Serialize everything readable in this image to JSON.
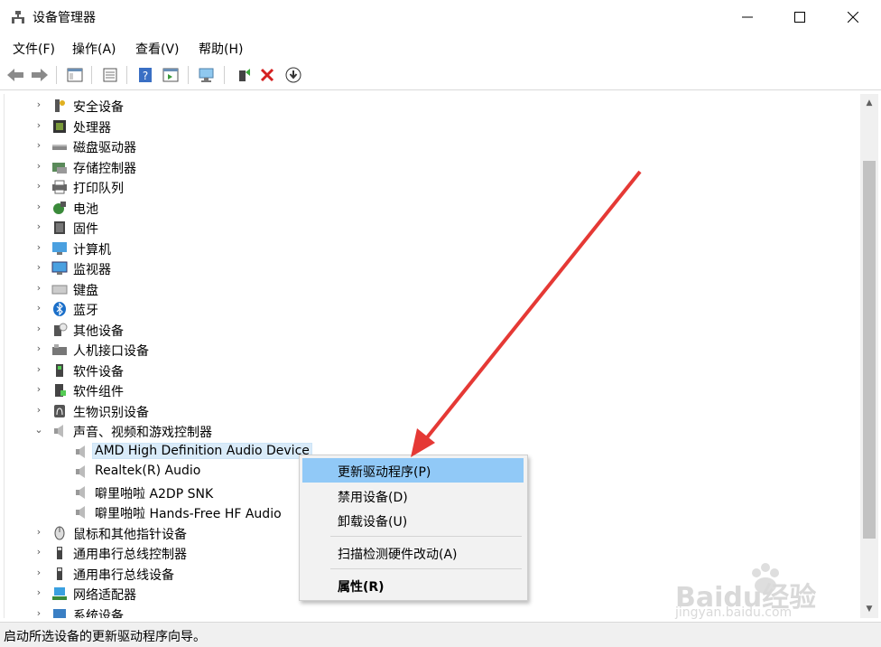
{
  "window": {
    "title": "设备管理器"
  },
  "menu": [
    "文件(F)",
    "操作(A)",
    "查看(V)",
    "帮助(H)"
  ],
  "tree": {
    "categories_before": [
      {
        "label": "安全设备",
        "icon": "security-device-icon"
      },
      {
        "label": "处理器",
        "icon": "processor-icon"
      },
      {
        "label": "磁盘驱动器",
        "icon": "disk-drive-icon"
      },
      {
        "label": "存储控制器",
        "icon": "storage-controller-icon"
      },
      {
        "label": "打印队列",
        "icon": "printer-icon"
      },
      {
        "label": "电池",
        "icon": "battery-icon"
      },
      {
        "label": "固件",
        "icon": "firmware-icon"
      },
      {
        "label": "计算机",
        "icon": "computer-icon"
      },
      {
        "label": "监视器",
        "icon": "monitor-icon"
      },
      {
        "label": "键盘",
        "icon": "keyboard-icon"
      },
      {
        "label": "蓝牙",
        "icon": "bluetooth-icon"
      },
      {
        "label": "其他设备",
        "icon": "other-devices-icon"
      },
      {
        "label": "人机接口设备",
        "icon": "hid-icon"
      },
      {
        "label": "软件设备",
        "icon": "software-device-icon"
      },
      {
        "label": "软件组件",
        "icon": "software-component-icon"
      },
      {
        "label": "生物识别设备",
        "icon": "biometric-icon"
      }
    ],
    "expanded_category": {
      "label": "声音、视频和游戏控制器",
      "icon": "speaker-icon"
    },
    "children": [
      {
        "label": "AMD High Definition Audio Device",
        "selected": true
      },
      {
        "label": "Realtek(R) Audio",
        "selected": false
      },
      {
        "label": "噼里啪啦 A2DP SNK",
        "selected": false
      },
      {
        "label": "噼里啪啦 Hands-Free HF Audio",
        "selected": false
      }
    ],
    "categories_after": [
      {
        "label": "鼠标和其他指针设备",
        "icon": "mouse-icon"
      },
      {
        "label": "通用串行总线控制器",
        "icon": "usb-controller-icon"
      },
      {
        "label": "通用串行总线设备",
        "icon": "usb-device-icon"
      },
      {
        "label": "网络适配器",
        "icon": "network-adapter-icon"
      },
      {
        "label": "系统设备",
        "icon": "system-device-icon"
      }
    ]
  },
  "context_menu": {
    "update_driver": "更新驱动程序(P)",
    "disable_device": "禁用设备(D)",
    "uninstall_device": "卸载设备(U)",
    "scan_hardware": "扫描检测硬件改动(A)",
    "properties": "属性(R)"
  },
  "status_bar": {
    "text": "启动所选设备的更新驱动程序向导。"
  },
  "watermark": {
    "text_main": "Baidu经验",
    "text_sub": "jingyan.baidu.com"
  },
  "colors": {
    "highlight": "#91c9f7",
    "selected_row": "#d9ebf9",
    "annotation_arrow": "#e53935"
  }
}
